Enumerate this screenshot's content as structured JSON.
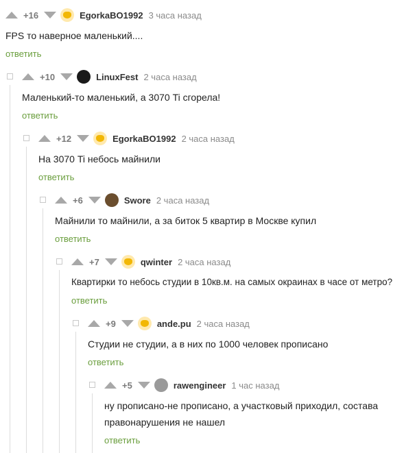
{
  "reply_label": "ответить",
  "comments": [
    {
      "rating": "+16",
      "user": "EgorkaBO1992",
      "time": "3 часа назад",
      "text": "FPS то наверное маленький...."
    },
    {
      "rating": "+10",
      "user": "LinuxFest",
      "time": "2 часа назад",
      "text": "Маленький-то маленький, а 3070 Ti сгорела!"
    },
    {
      "rating": "+12",
      "user": "EgorkaBO1992",
      "time": "2 часа назад",
      "text": "На 3070 Ti небось майнили"
    },
    {
      "rating": "+6",
      "user": "Swore",
      "time": "2 часа назад",
      "text": "Майнили то майнили, а за биток 5 квартир в Москве купил"
    },
    {
      "rating": "+7",
      "user": "qwinter",
      "time": "2 часа назад",
      "text": "Квартирки то небось студии в 10кв.м. на самых окраинах в часе от метро?"
    },
    {
      "rating": "+9",
      "user": "ande.pu",
      "time": "2 часа назад",
      "text": "Студии не студии, а в них по 1000 человек прописано"
    },
    {
      "rating": "+5",
      "user": "rawengineer",
      "time": "1 час назад",
      "text_line1": "ну прописано-не прописано, а участковый приходил, состава",
      "text_line2": "правонарушения не нашел"
    }
  ]
}
